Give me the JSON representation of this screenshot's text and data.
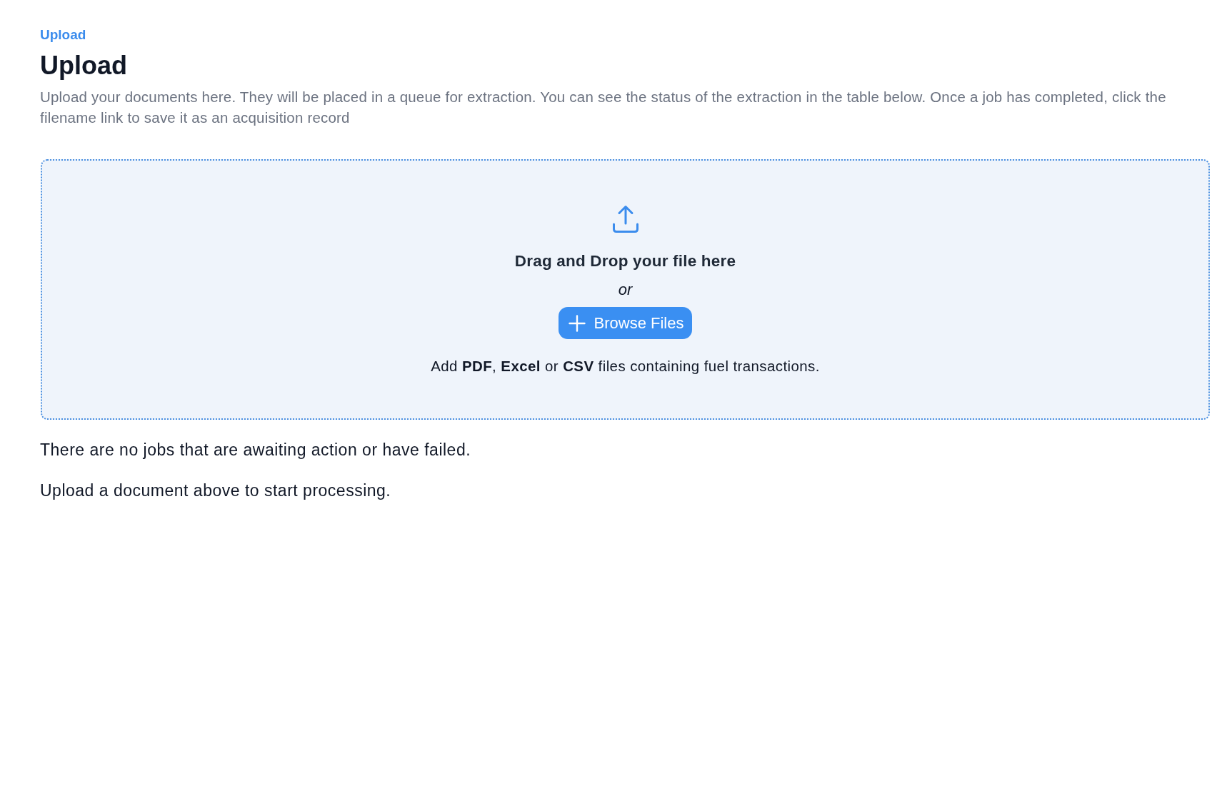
{
  "breadcrumb": [
    {
      "label": "Upload"
    }
  ],
  "page": {
    "title": "Upload",
    "description": "Upload your documents here. They will be placed in a queue for extraction. You can see the status of the extraction in the table below. Once a job has completed, click the filename link to save it as an acquisition record"
  },
  "dropzone": {
    "prompt": "Drag and Drop your file here",
    "separator": "or",
    "button": "Browse Files",
    "hint": "Add **PDF**, **Excel** or **CSV** files containing fuel transactions."
  },
  "messages": [
    "There are no jobs that are awaiting action or have failed.",
    "Upload a document above to start processing."
  ]
}
